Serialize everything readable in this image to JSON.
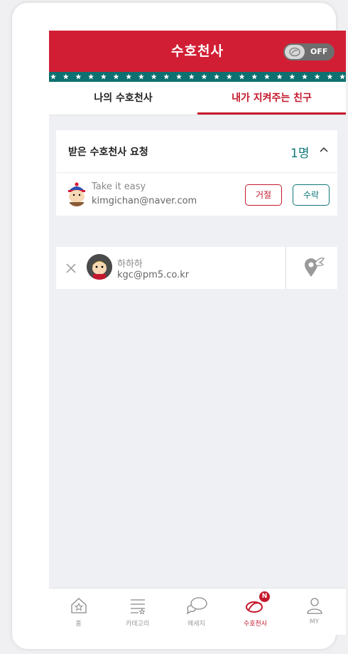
{
  "header": {
    "title": "수호천사",
    "toggle_label": "OFF"
  },
  "tabs": [
    {
      "label": "나의 수호천사"
    },
    {
      "label": "내가 지켜주는 친구"
    }
  ],
  "requests": {
    "title": "받은 수호천사 요청",
    "count": "1명",
    "items": [
      {
        "name": "Take it easy",
        "email": "kimgichan@naver.com",
        "reject_label": "거절",
        "accept_label": "수락"
      }
    ]
  },
  "friends": [
    {
      "name": "하하하",
      "email": "kgc@pm5.co.kr"
    }
  ],
  "nav": [
    {
      "label": "홈",
      "icon": "home-icon"
    },
    {
      "label": "카테고리",
      "icon": "category-icon"
    },
    {
      "label": "메세지",
      "icon": "message-icon"
    },
    {
      "label": "수호천사",
      "icon": "guardian-icon",
      "badge": "N"
    },
    {
      "label": "MY",
      "icon": "user-icon"
    }
  ],
  "colors": {
    "brand_red": "#d21e34",
    "teal": "#117777"
  }
}
